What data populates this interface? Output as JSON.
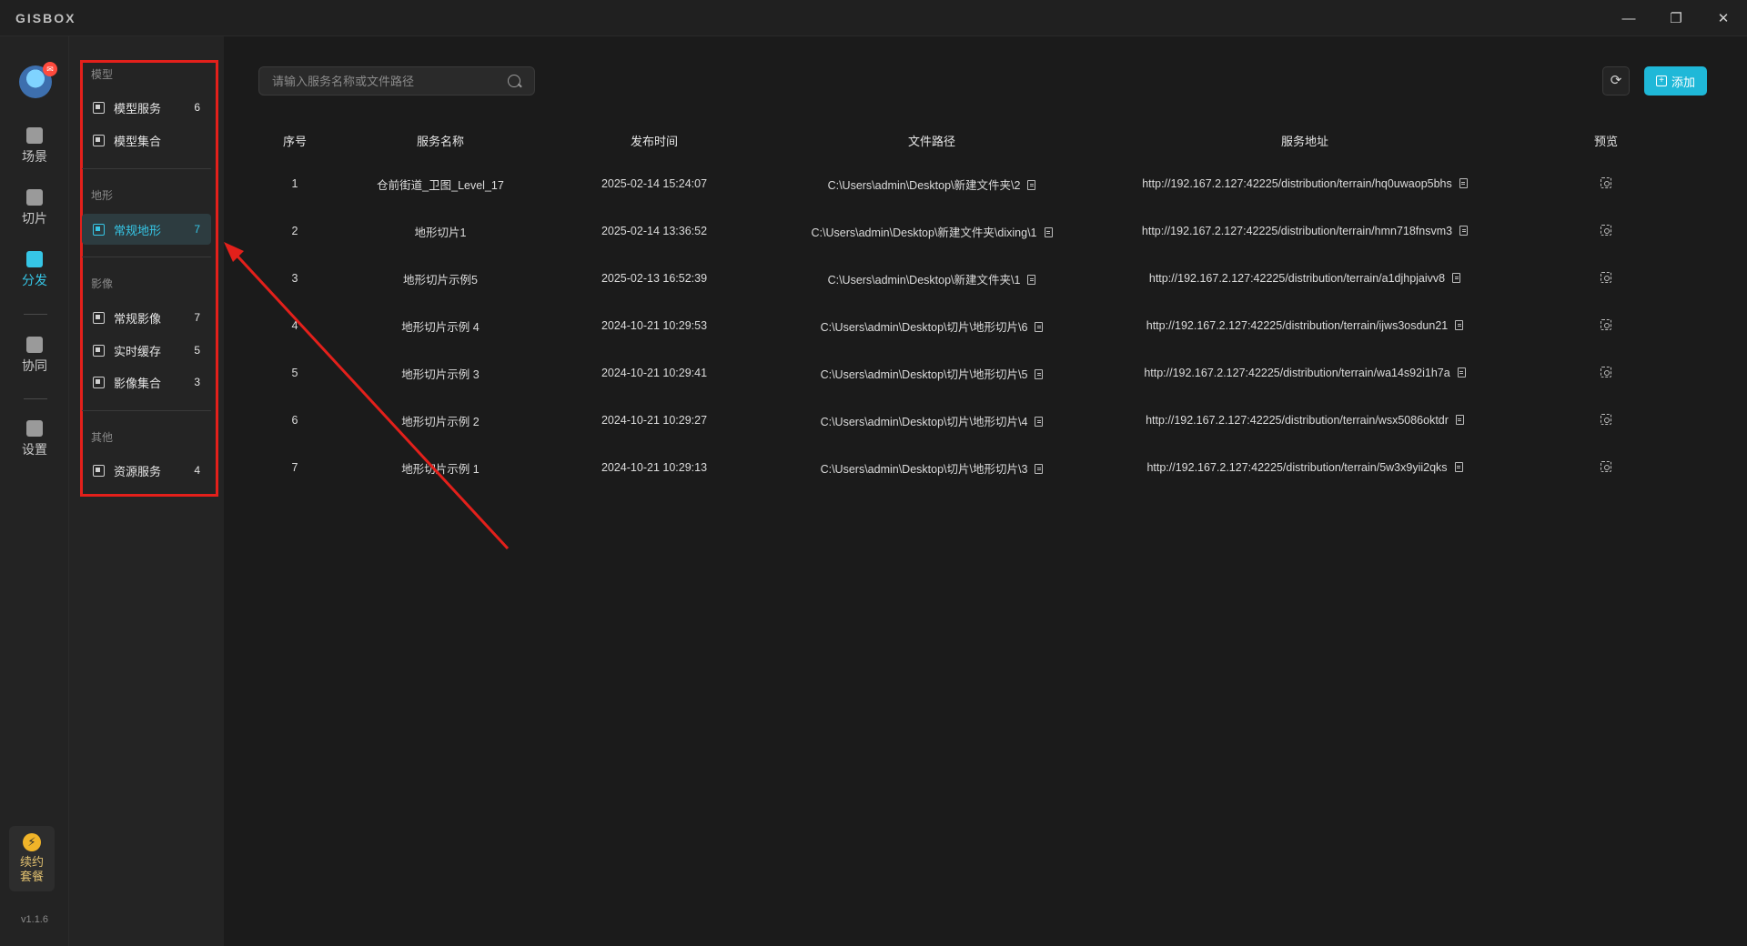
{
  "app": {
    "logo_text": "GISBOX",
    "version": "v1.1.6"
  },
  "window_controls": {
    "minimize": "—",
    "restore": "❐",
    "close": "✕"
  },
  "rail": {
    "avatar_badge": "✉",
    "items": [
      {
        "label": "场景",
        "icon": "scene-icon"
      },
      {
        "label": "切片",
        "icon": "slice-icon"
      },
      {
        "label": "分发",
        "icon": "distribute-icon",
        "active": true
      },
      {
        "label": "协同",
        "icon": "collab-icon"
      },
      {
        "label": "设置",
        "icon": "settings-icon"
      }
    ],
    "renew": {
      "icon": "⚡",
      "line1": "续约",
      "line2": "套餐"
    }
  },
  "subnav": {
    "groups": [
      {
        "title": "模型",
        "items": [
          {
            "label": "模型服务",
            "count": "6"
          },
          {
            "label": "模型集合",
            "count": ""
          }
        ]
      },
      {
        "title": "地形",
        "items": [
          {
            "label": "常规地形",
            "count": "7",
            "active": true
          }
        ]
      },
      {
        "title": "影像",
        "items": [
          {
            "label": "常规影像",
            "count": "7"
          },
          {
            "label": "实时缓存",
            "count": "5"
          },
          {
            "label": "影像集合",
            "count": "3"
          }
        ]
      },
      {
        "title": "其他",
        "items": [
          {
            "label": "资源服务",
            "count": "4"
          }
        ]
      }
    ]
  },
  "toolbar": {
    "search_placeholder": "请输入服务名称或文件路径",
    "refresh_icon": "⟳",
    "add_label": "添加"
  },
  "table": {
    "headers": [
      "序号",
      "服务名称",
      "发布时间",
      "文件路径",
      "服务地址",
      "预览"
    ],
    "rows": [
      {
        "index": "1",
        "name": "仓前街道_卫图_Level_17",
        "time": "2025-02-14 15:24:07",
        "path": "C:\\Users\\admin\\Desktop\\新建文件夹\\2",
        "url": "http://192.167.2.127:42225/distribution/terrain/hq0uwaop5bhs"
      },
      {
        "index": "2",
        "name": "地形切片1",
        "time": "2025-02-14 13:36:52",
        "path": "C:\\Users\\admin\\Desktop\\新建文件夹\\dixing\\1",
        "url": "http://192.167.2.127:42225/distribution/terrain/hmn718fnsvm3"
      },
      {
        "index": "3",
        "name": "地形切片示例5",
        "time": "2025-02-13 16:52:39",
        "path": "C:\\Users\\admin\\Desktop\\新建文件夹\\1",
        "url": "http://192.167.2.127:42225/distribution/terrain/a1djhpjaivv8"
      },
      {
        "index": "4",
        "name": "地形切片示例 4",
        "time": "2024-10-21 10:29:53",
        "path": "C:\\Users\\admin\\Desktop\\切片\\地形切片\\6",
        "url": "http://192.167.2.127:42225/distribution/terrain/ijws3osdun21"
      },
      {
        "index": "5",
        "name": "地形切片示例 3",
        "time": "2024-10-21 10:29:41",
        "path": "C:\\Users\\admin\\Desktop\\切片\\地形切片\\5",
        "url": "http://192.167.2.127:42225/distribution/terrain/wa14s92i1h7a"
      },
      {
        "index": "6",
        "name": "地形切片示例 2",
        "time": "2024-10-21 10:29:27",
        "path": "C:\\Users\\admin\\Desktop\\切片\\地形切片\\4",
        "url": "http://192.167.2.127:42225/distribution/terrain/wsx5086oktdr"
      },
      {
        "index": "7",
        "name": "地形切片示例 1",
        "time": "2024-10-21 10:29:13",
        "path": "C:\\Users\\admin\\Desktop\\切片\\地形切片\\3",
        "url": "http://192.167.2.127:42225/distribution/terrain/5w3x9yii2qks"
      }
    ]
  },
  "annotation": {
    "color": "#e3201b"
  },
  "colors": {
    "accent": "#36c6e6",
    "add_button": "#1fb8d8",
    "background": "#1b1b1b"
  }
}
